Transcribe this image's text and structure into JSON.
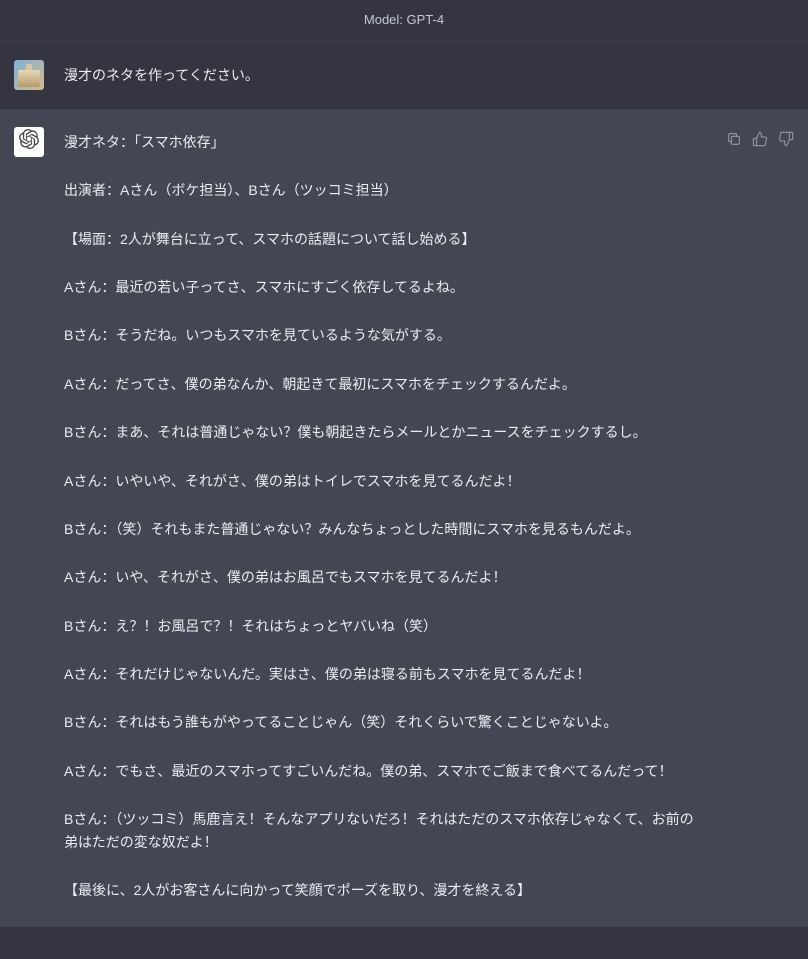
{
  "header": {
    "model_label": "Model: GPT-4"
  },
  "user_turn": {
    "text": "漫才のネタを作ってください。"
  },
  "assistant_turn": {
    "paragraphs": [
      "漫才ネタ：「スマホ依存」",
      "出演者：Aさん（ボケ担当）、Bさん（ツッコミ担当）",
      "【場面：2人が舞台に立って、スマホの話題について話し始める】",
      "Aさん：最近の若い子ってさ、スマホにすごく依存してるよね。",
      "Bさん：そうだね。いつもスマホを見ているような気がする。",
      "Aさん：だってさ、僕の弟なんか、朝起きて最初にスマホをチェックするんだよ。",
      "Bさん：まあ、それは普通じゃない？僕も朝起きたらメールとかニュースをチェックするし。",
      "Aさん：いやいや、それがさ、僕の弟はトイレでスマホを見てるんだよ！",
      "Bさん：（笑）それもまた普通じゃない？みんなちょっとした時間にスマホを見るもんだよ。",
      "Aさん：いや、それがさ、僕の弟はお風呂でもスマホを見てるんだよ！",
      "Bさん：え？！お風呂で？！それはちょっとヤバいね（笑）",
      "Aさん：それだけじゃないんだ。実はさ、僕の弟は寝る前もスマホを見てるんだよ！",
      "Bさん：それはもう誰もがやってることじゃん（笑）それくらいで驚くことじゃないよ。",
      "Aさん：でもさ、最近のスマホってすごいんだね。僕の弟、スマホでご飯まで食べてるんだって！",
      "Bさん：（ツッコミ）馬鹿言え！そんなアプリないだろ！それはただのスマホ依存じゃなくて、お前の弟はただの変な奴だよ！",
      "【最後に、2人がお客さんに向かって笑顔でポーズを取り、漫才を終える】"
    ]
  },
  "actions": {
    "copy": "copy",
    "thumbs_up": "thumbs-up",
    "thumbs_down": "thumbs-down"
  }
}
